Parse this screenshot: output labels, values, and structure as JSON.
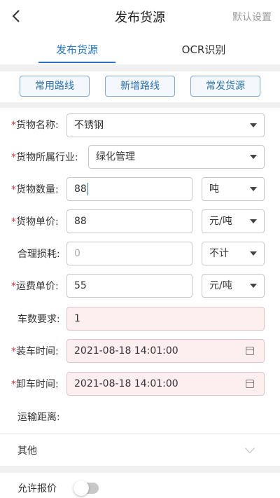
{
  "header": {
    "title": "发布货源",
    "right_action": "默认设置",
    "back_icon": "chevron-left-icon"
  },
  "tabs": [
    {
      "label": "发布货源",
      "active": true
    },
    {
      "label": "OCR识别",
      "active": false
    }
  ],
  "route_buttons": [
    "常用路线",
    "新增路线",
    "常发货源"
  ],
  "form": {
    "cargo_name": {
      "label": "货物名称:",
      "value": "不锈钢",
      "required": true
    },
    "industry": {
      "label": "货物所属行业:",
      "value": "绿化管理",
      "required": true
    },
    "quantity": {
      "label": "货物数量:",
      "value": "88",
      "unit": "吨",
      "required": true
    },
    "unit_price": {
      "label": "货物单价:",
      "value": "88",
      "unit": "元/吨",
      "required": true
    },
    "loss": {
      "label": "合理损耗:",
      "placeholder": "0",
      "unit": "不计",
      "required": false
    },
    "freight_price": {
      "label": "运费单价:",
      "value": "55",
      "unit": "元/吨",
      "required": true
    },
    "truck_count": {
      "label": "车数要求:",
      "value": "1",
      "required": false
    },
    "load_time": {
      "label": "装车时间:",
      "value": "2021-08-18 14:01:00",
      "required": true
    },
    "unload_time": {
      "label": "卸车时间:",
      "value": "2021-08-18 14:01:00",
      "required": true
    },
    "distance": {
      "label": "运输距离:",
      "required": false
    }
  },
  "star": "*",
  "other": {
    "label": "其他"
  },
  "allow_quote": {
    "label": "允许报价",
    "enabled": false
  },
  "colors": {
    "accent": "#2a78c8",
    "required": "#d9363e",
    "pink_field": "#fdeef0"
  }
}
